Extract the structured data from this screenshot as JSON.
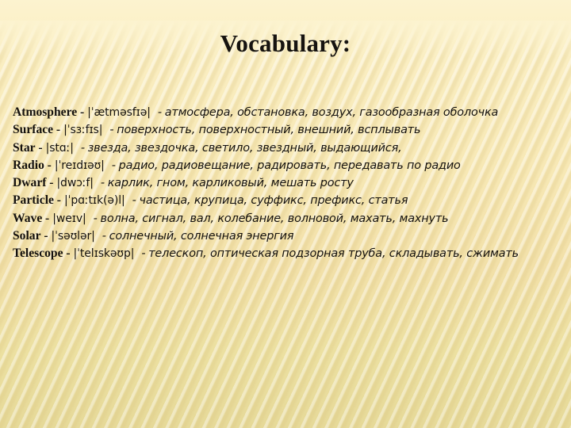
{
  "slide": {
    "title": "Vocabulary:",
    "background_top_color": "#fcf3cf",
    "background_bottom_color": "#e6d998",
    "text_color": "#14110e"
  },
  "vocabulary": [
    {
      "term": "Atmosphere",
      "separator": "-",
      "transcription": "|ˈætməsfɪə|",
      "translation_dash": "-",
      "translation": "атмосфера, обстановка, воздух, газообразная оболочка"
    },
    {
      "term": "Surface",
      "separator": "-",
      "transcription": "|ˈsɜːfɪs|",
      "translation_dash": "-",
      "translation": "поверхность, поверхностный, внешний, всплывать"
    },
    {
      "term": "Star",
      "separator": "-",
      "transcription": "|stɑː|",
      "translation_dash": "-",
      "translation": "звезда, звездочка, светило, звездный, выдающийся,"
    },
    {
      "term": "Radio",
      "separator": "-",
      "transcription": "|ˈreɪdɪəʊ|",
      "translation_dash": "-",
      "translation": "радио, радиовещание, радировать, передавать по радио"
    },
    {
      "term": "Dwarf",
      "separator": "-",
      "transcription": "|dwɔːf|",
      "translation_dash": "-",
      "translation": "карлик, гном, карликовый, мешать росту"
    },
    {
      "term": "Particle",
      "separator": "-",
      "transcription": "|ˈpɑːtɪk(ə)l|",
      "translation_dash": "-",
      "translation": "частица, крупица, суффикс, префикс, статья"
    },
    {
      "term": "Wave",
      "separator": "-",
      "transcription": "|weɪv|",
      "translation_dash": "-",
      "translation": "волна, сигнал, вал, колебание, волновой, махать, махнуть"
    },
    {
      "term": "Solar",
      "separator": "-",
      "transcription": "|ˈsəʊlər|",
      "translation_dash": "-",
      "translation": "солнечный, солнечная энергия"
    },
    {
      "term": "Telescope",
      "separator": "-",
      "transcription": "|ˈtelɪskəʊp|",
      "translation_dash": "-",
      "translation": "телескоп, оптическая подзорная труба, складывать, сжимать"
    }
  ]
}
